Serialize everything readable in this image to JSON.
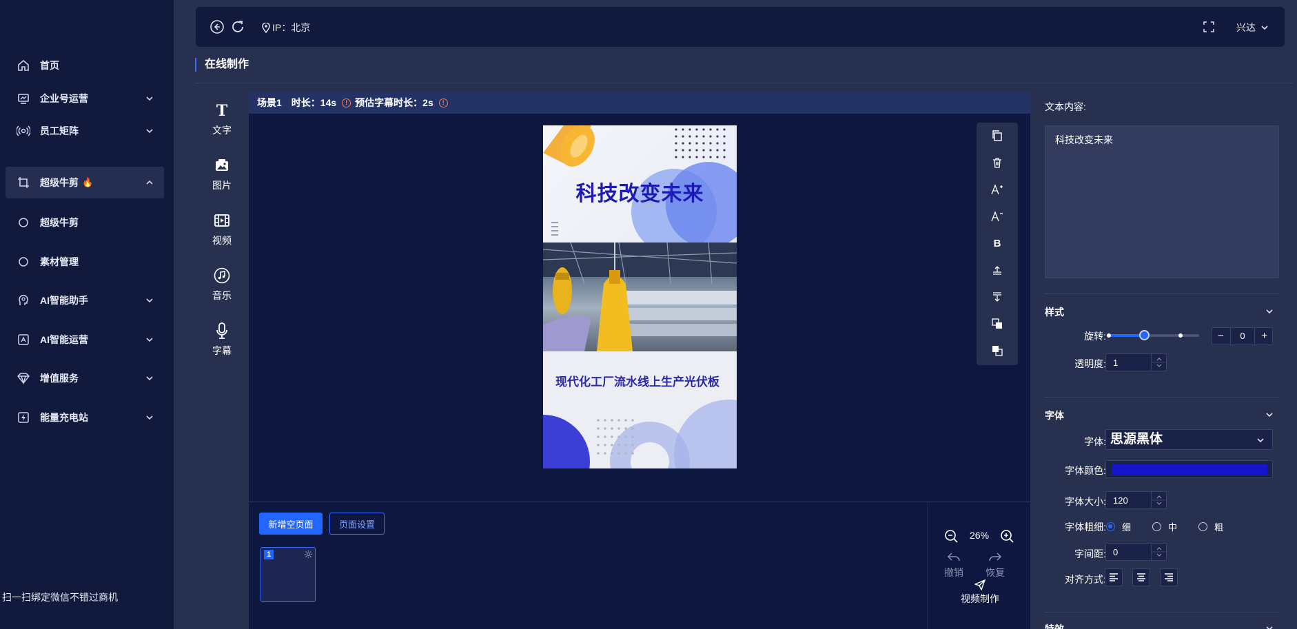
{
  "sidebar": {
    "items": [
      {
        "label": "首页",
        "icon": "home-icon"
      },
      {
        "label": "企业号运营",
        "icon": "monitor-chart-icon"
      },
      {
        "label": "员工矩阵",
        "icon": "broadcast-icon"
      },
      {
        "label": "超级牛剪",
        "icon": "crop-icon",
        "badge": "🔥"
      },
      {
        "label": "超级牛剪",
        "icon": "circle-icon"
      },
      {
        "label": "素材管理",
        "icon": "circle-icon"
      },
      {
        "label": "AI智能助手",
        "icon": "ai-head-icon"
      },
      {
        "label": "AI智能运营",
        "icon": "ai-ops-icon"
      },
      {
        "label": "增值服务",
        "icon": "diamond-icon"
      },
      {
        "label": "能量充电站",
        "icon": "battery-bolt-icon"
      }
    ],
    "footer": "扫一扫绑定微信不错过商机"
  },
  "topbar": {
    "ip_label": "IP：北京",
    "user": "兴达"
  },
  "page_title": "在线制作",
  "tools": [
    "文字",
    "图片",
    "视频",
    "音乐",
    "字幕"
  ],
  "scene": {
    "name": "场景1",
    "duration_label": "时长：14s",
    "subtitle_label": "预估字幕时长：2s"
  },
  "preview": {
    "headline": "科技改变未来",
    "caption": "现代化工厂流水线上生产光伏板"
  },
  "pages": {
    "add_label": "新增空页面",
    "settings_label": "页面设置",
    "thumb_number": "1"
  },
  "zoom": {
    "value": "26%",
    "undo_label": "撤销",
    "redo_label": "恢复",
    "make_video_label": "视频制作"
  },
  "props": {
    "text_content_label": "文本内容:",
    "text_content_value": "科技改变未来",
    "style_section": "样式",
    "rotation_label": "旋转:",
    "rotation_value": "0",
    "rotation_fraction": 0.4,
    "opacity_label": "透明度:",
    "opacity_value": "1",
    "font_section": "字体",
    "font_label": "字体:",
    "font_value": "思源黑体",
    "font_color_label": "字体颜色:",
    "font_color": "#1414c8",
    "font_size_label": "字体大小:",
    "font_size_value": "120",
    "font_weight_label": "字体粗细:",
    "weights": [
      "细",
      "中",
      "粗"
    ],
    "letter_spacing_label": "字间距:",
    "letter_spacing_value": "0",
    "align_label": "对齐方式:",
    "effects_section": "特效"
  },
  "colors": {
    "accent": "#2166ff",
    "sidebar_bg": "#111a3d",
    "canvas_bg": "#0e1740"
  }
}
